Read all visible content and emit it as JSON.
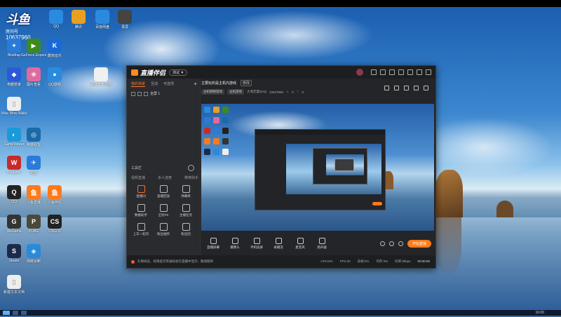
{
  "desktop": {
    "logo": {
      "text": "斗鱼",
      "sub": "房间号",
      "room": "10637960"
    },
    "left_icons": [
      {
        "label": "BitsMap",
        "color": "#2a7ad8",
        "glyph": "✦"
      },
      {
        "label": "GeForce Experience",
        "color": "#3c8a1e",
        "glyph": "▶"
      },
      {
        "label": "酷狗音乐",
        "color": "#1a6ad6",
        "glyph": "K"
      },
      {
        "label": "电脑管家",
        "color": "#2a5ad8",
        "glyph": "◆"
      },
      {
        "label": "图片查看",
        "color": "#e06aa0",
        "glyph": "❀"
      },
      {
        "label": "QQ游戏",
        "color": "#2a8ae0",
        "glyph": "●"
      },
      {
        "label": "Wee Wow Wallet",
        "color": "#eeeeee",
        "glyph": "▯"
      },
      {
        "label": "GameViewer",
        "color": "#1a9ad8",
        "glyph": "◐"
      },
      {
        "label": "英雄联盟",
        "color": "#1a6aa8",
        "glyph": "◎"
      },
      {
        "label": "Wegame",
        "color": "#c82a2a",
        "glyph": "W"
      },
      {
        "label": "迅雷",
        "color": "#2a7ad8",
        "glyph": "✈"
      },
      {
        "label": "QQ",
        "color": "#222222",
        "glyph": "Q"
      },
      {
        "label": "斗鱼直播",
        "color": "#ff7a1a",
        "glyph": "鱼"
      },
      {
        "label": "斗鱼伴侣",
        "color": "#ff7a1a",
        "glyph": "鱼"
      },
      {
        "label": "WeGame",
        "color": "#333333",
        "glyph": "G"
      },
      {
        "label": "PUBG",
        "color": "#4a4a3a",
        "glyph": "P"
      },
      {
        "label": "CSGO2",
        "color": "#222222",
        "glyph": "CS"
      },
      {
        "label": "Steam",
        "color": "#1b2a4a",
        "glyph": "S"
      },
      {
        "label": "网络诊断",
        "color": "#2a8ad8",
        "glyph": "◈"
      },
      {
        "label": "新建文本文档",
        "color": "#eeeeee",
        "glyph": "▯"
      }
    ],
    "top_icons": [
      {
        "label": "QQ",
        "color": "#2a8ae0"
      },
      {
        "label": "腾讯",
        "color": "#e8a020"
      },
      {
        "label": "百度网盘",
        "color": "#2a8ae0"
      },
      {
        "label": "录屏",
        "color": "#444444"
      }
    ],
    "file_icon": {
      "label": "新建文本文档"
    },
    "taskbar_time": "16:00"
  },
  "app": {
    "brand": "直播伴侣",
    "version": "测试 ▼",
    "left_tabs": [
      "我的场景",
      "互动",
      "可选项"
    ],
    "scene_label": "全屏 1",
    "tools_header": "工具栏",
    "tools_tabs": [
      "视频直播",
      "多人连麦",
      "推荐助手"
    ],
    "tools": [
      {
        "label": "直播间",
        "hot": true
      },
      {
        "label": "直播回放",
        "hot": false
      },
      {
        "label": "弹幕库",
        "hot": false
      },
      {
        "label": "数据助手",
        "hot": false
      },
      {
        "label": "全民PK",
        "hot": false
      },
      {
        "label": "主播任务",
        "hot": false
      },
      {
        "label": "上车一起玩",
        "hot": false
      },
      {
        "label": "粉丝抽奖",
        "hot": false
      },
      {
        "label": "粉丝团",
        "hot": false
      }
    ],
    "room_title": "主要玩的是主机内游戏",
    "room_tag": "修改",
    "room_chips": [
      "主机网络游戏",
      "主机游戏"
    ],
    "room_meta": [
      "大海无量QAQ",
      "10637960",
      "0",
      "0"
    ],
    "controls": [
      "直播屏幕",
      "摄像头",
      "手机投屏",
      "录播流",
      "麦克风",
      "扬声器"
    ],
    "go_live": "开始直播",
    "status_msg": "礼物排名、权限提示等通知会在直播中显示，敬请期待",
    "stats": [
      "CPU:0%",
      "FPS:30",
      "丢帧:0%",
      "内存:0%",
      "码率:0kbps"
    ],
    "elapsed": "00:00:00"
  }
}
